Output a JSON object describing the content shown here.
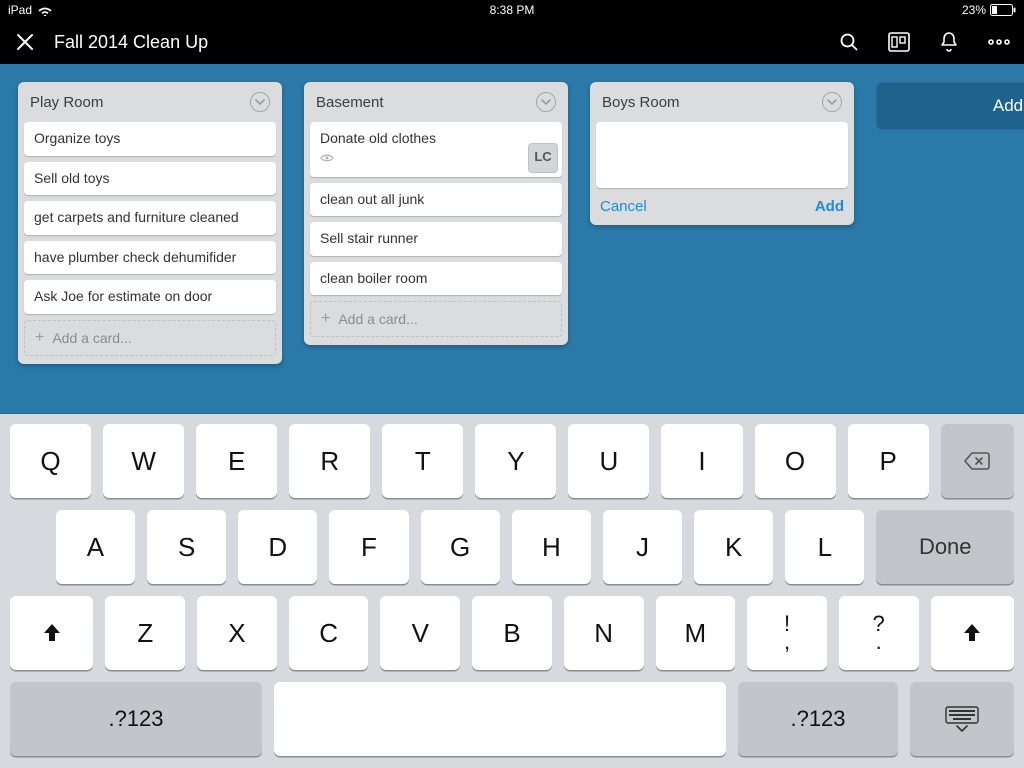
{
  "status_bar": {
    "device": "iPad",
    "time": "8:38 PM",
    "battery_text": "23%"
  },
  "header": {
    "title": "Fall 2014 Clean Up"
  },
  "board": {
    "add_list_label": "Add",
    "lists": [
      {
        "title": "Play Room",
        "cards": [
          {
            "text": "Organize toys"
          },
          {
            "text": "Sell old toys"
          },
          {
            "text": "get carpets and furniture cleaned"
          },
          {
            "text": "have plumber check dehumifider"
          },
          {
            "text": "Ask Joe for estimate on door"
          }
        ],
        "add_card_label": "Add a card..."
      },
      {
        "title": "Basement",
        "cards": [
          {
            "text": "Donate old clothes",
            "has_subscribe_icon": true,
            "member_initials": "LC"
          },
          {
            "text": "clean out all junk"
          },
          {
            "text": "Sell stair runner"
          },
          {
            "text": "clean boiler room"
          }
        ],
        "add_card_label": "Add a card..."
      },
      {
        "title": "Boys Room",
        "compose": {
          "cancel_label": "Cancel",
          "add_label": "Add"
        }
      }
    ]
  },
  "keyboard": {
    "row1": [
      "Q",
      "W",
      "E",
      "R",
      "T",
      "Y",
      "U",
      "I",
      "O",
      "P"
    ],
    "row2": [
      "A",
      "S",
      "D",
      "F",
      "G",
      "H",
      "J",
      "K",
      "L"
    ],
    "done_label": "Done",
    "row3": [
      "Z",
      "X",
      "C",
      "V",
      "B",
      "N",
      "M"
    ],
    "punct1_top": "!",
    "punct1_bot": ",",
    "punct2_top": "?",
    "punct2_bot": ".",
    "num_label": ".?123"
  }
}
